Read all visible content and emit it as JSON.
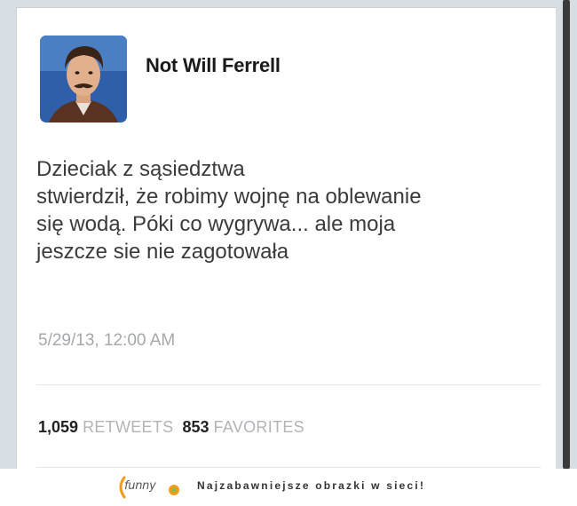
{
  "tweet": {
    "user_name": "Not Will Ferrell",
    "text_lines": [
      "Dzieciak z sąsiedztwa",
      "stwierdził, że robimy wojnę na oblewanie",
      "się wodą. Póki co wygrywa... ale moja",
      "jeszcze sie nie zagotowała"
    ],
    "timestamp": "5/29/13, 12:00 AM",
    "retweets_count": "1,059",
    "retweets_label": "RETWEETS",
    "favorites_count": "853",
    "favorites_label": "FAVORITES"
  },
  "footer": {
    "logo_text": "funny",
    "tagline": "Najzabawniejsze obrazki w sieci!"
  },
  "colors": {
    "backdrop": "#d6dde3",
    "logo_orange": "#f39a1e",
    "logo_green": "#7dc242"
  },
  "icons": {
    "avatar": "user-avatar-photo",
    "logo": "funny-logo-icon"
  }
}
